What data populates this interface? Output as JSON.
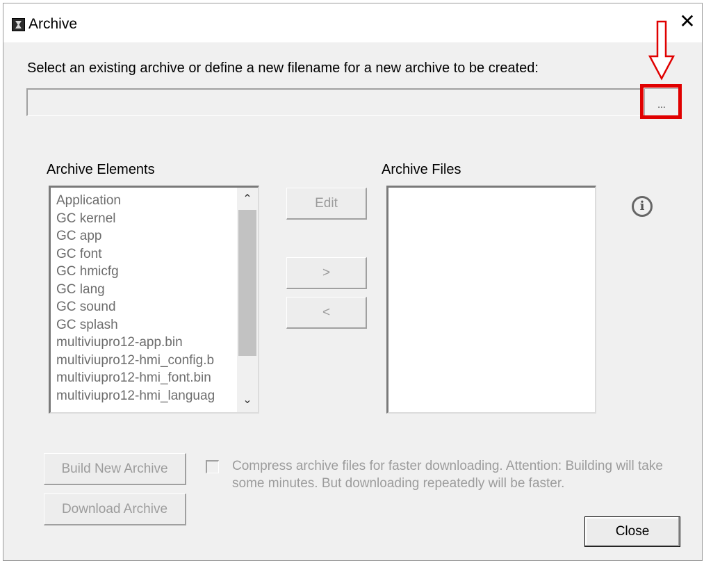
{
  "window": {
    "title": "Archive",
    "close_glyph": "✕"
  },
  "prompt": "Select an existing archive or define a new filename for a new archive to be created:",
  "archive_path": {
    "value": "",
    "browse_label": "..."
  },
  "archive_elements": {
    "label": "Archive Elements",
    "items": [
      "Application",
      "GC kernel",
      "GC app",
      "GC font",
      "GC hmicfg",
      "GC lang",
      "GC sound",
      "GC splash",
      "multiviupro12-app.bin",
      "multiviupro12-hmi_config.b",
      "multiviupro12-hmi_font.bin",
      "multiviupro12-hmi_languag"
    ],
    "scroll_up_glyph": "⌃",
    "scroll_down_glyph": "⌄"
  },
  "archive_files": {
    "label": "Archive Files",
    "items": []
  },
  "buttons": {
    "edit": "Edit",
    "add": ">",
    "remove": "<",
    "build": "Build New Archive",
    "download": "Download Archive",
    "close": "Close"
  },
  "compress_option": {
    "checked": false,
    "label": "Compress archive files for faster downloading. Attention: Building will take some minutes. But downloading repeatedly will be faster."
  },
  "info_glyph": "i",
  "colors": {
    "highlight": "#e00000",
    "disabled_text": "#9c9c9c"
  }
}
